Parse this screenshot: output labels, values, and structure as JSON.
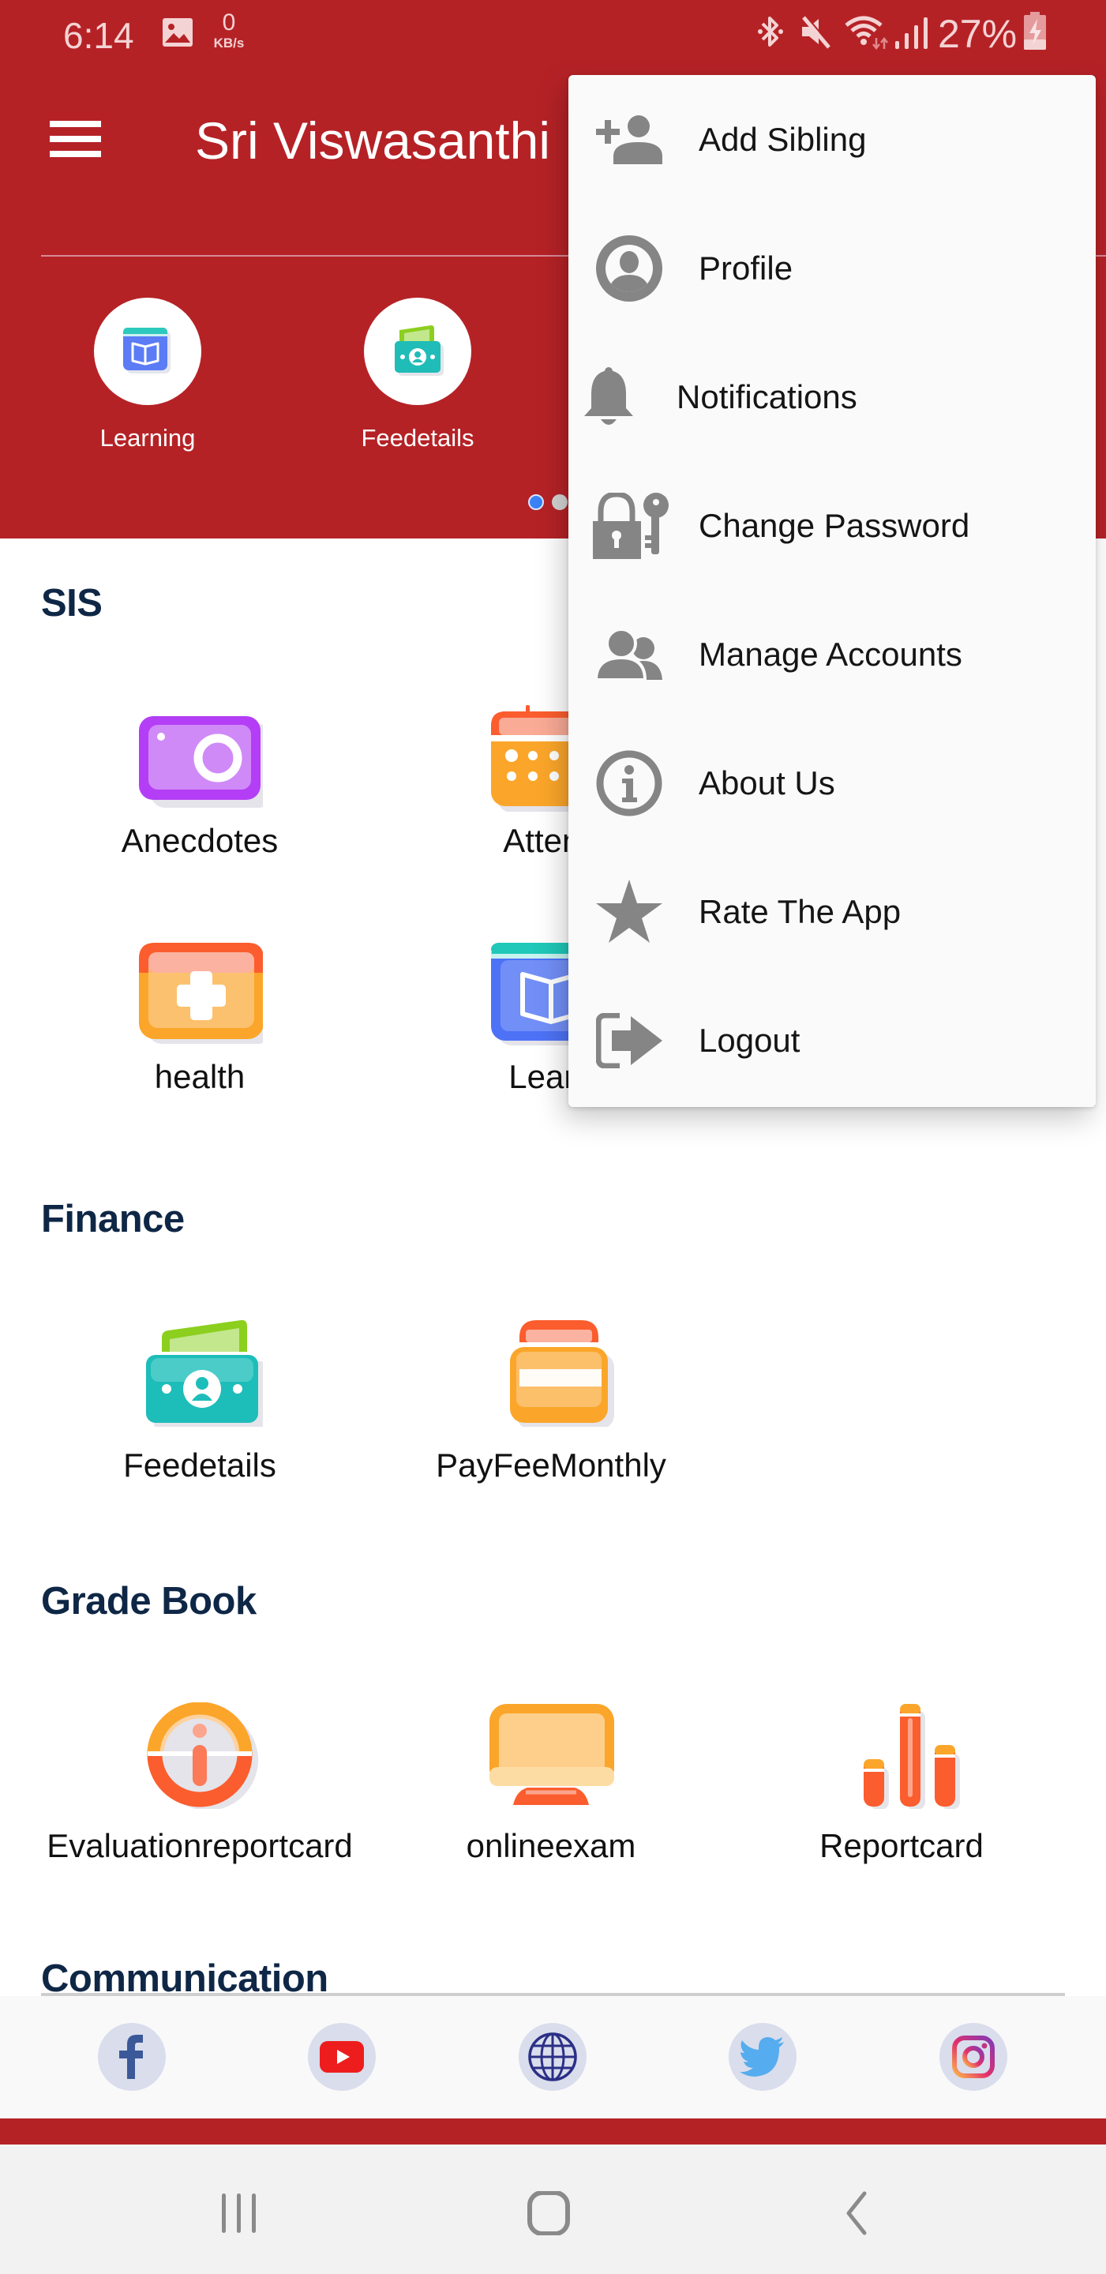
{
  "status_bar": {
    "time": "6:14",
    "net_speed_value": "0",
    "net_speed_unit": "KB/s",
    "battery_percent": "27%",
    "icons": [
      "gallery-notification-icon",
      "bluetooth-icon",
      "mute-icon",
      "wifi-icon",
      "signal-icon",
      "battery-charging-icon"
    ]
  },
  "app_bar": {
    "title": "Sri Viswasanthi",
    "menu_icon": "hamburger-icon"
  },
  "quick_access": {
    "items": [
      {
        "label": "Learning",
        "icon": "learning-book-icon"
      },
      {
        "label": "Feedetails",
        "icon": "fee-wallet-icon"
      }
    ],
    "carousel": {
      "page_count_visible": 2,
      "active_index": 0
    },
    "colors": {
      "active_dot": "#3b82f6",
      "inactive_dot": "#d4d4d4"
    }
  },
  "sections": [
    {
      "title": "SIS",
      "items": [
        {
          "label": "Anecdotes",
          "icon": "camera-icon"
        },
        {
          "label": "Attend",
          "icon": "calendar-icon"
        },
        {
          "label": "health",
          "icon": "health-kit-icon"
        },
        {
          "label": "Learn",
          "icon": "learning-book-icon"
        }
      ]
    },
    {
      "title": "Finance",
      "items": [
        {
          "label": "Feedetails",
          "icon": "fee-wallet-icon"
        },
        {
          "label": "PayFeeMonthly",
          "icon": "credit-card-icon"
        }
      ]
    },
    {
      "title": "Grade Book",
      "items": [
        {
          "label": "Evaluationreportcard",
          "icon": "evaluation-info-icon"
        },
        {
          "label": "onlineexam",
          "icon": "monitor-icon"
        },
        {
          "label": "Reportcard",
          "icon": "bar-chart-icon"
        }
      ]
    },
    {
      "title": "Communication",
      "items": []
    }
  ],
  "social_links": [
    {
      "name": "Facebook",
      "icon": "facebook-icon"
    },
    {
      "name": "YouTube",
      "icon": "youtube-icon"
    },
    {
      "name": "Website",
      "icon": "globe-icon"
    },
    {
      "name": "Twitter",
      "icon": "twitter-icon"
    },
    {
      "name": "Instagram",
      "icon": "instagram-icon"
    }
  ],
  "overflow_menu": {
    "items": [
      {
        "label": "Add Sibling",
        "icon": "add-person-icon"
      },
      {
        "label": "Profile",
        "icon": "profile-circle-icon"
      },
      {
        "label": "Notifications",
        "icon": "bell-icon"
      },
      {
        "label": "Change Password",
        "icon": "lock-key-icon"
      },
      {
        "label": "Manage Accounts",
        "icon": "users-icon"
      },
      {
        "label": "About Us",
        "icon": "info-icon"
      },
      {
        "label": "Rate The App",
        "icon": "star-icon"
      },
      {
        "label": "Logout",
        "icon": "logout-icon"
      }
    ]
  },
  "nav_bar": {
    "buttons": [
      "recents",
      "home",
      "back"
    ]
  },
  "theme": {
    "primary": "#b52226",
    "section_title": "#0f2746",
    "menu_icon_gray": "#858585"
  }
}
